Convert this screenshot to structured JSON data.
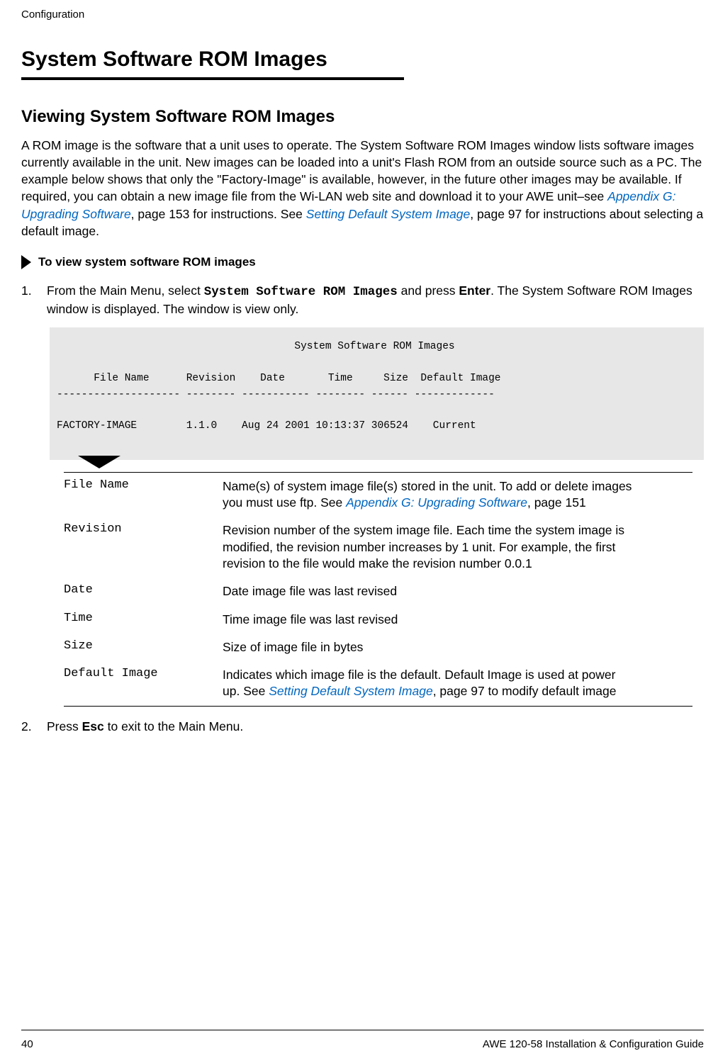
{
  "header": {
    "section_label": "Configuration"
  },
  "section": {
    "title": "System Software ROM Images"
  },
  "subsection": {
    "title": "Viewing System Software ROM Images",
    "intro_pre": "A ROM image is the software that a unit uses to operate. The System Software ROM Images window lists software images currently available in the unit. New images can be loaded into a unit's Flash ROM from an outside source such as a PC. The example below shows that only the \"Factory-Image\" is available, however, in the future other images may be available. If required, you can obtain a new image file from the Wi-LAN web site and download it to your AWE unit–see ",
    "intro_link1": "Appendix G: Upgrading Software",
    "intro_mid": ", page 153 for instructions. See ",
    "intro_link2": "Setting Default System Image",
    "intro_post": ", page 97 for instructions about selecting a default image."
  },
  "procedure": {
    "heading": "To view system software ROM images",
    "step1_pre": "From the Main Menu, select ",
    "step1_mono": "System Software ROM Images",
    "step1_mid": " and press ",
    "step1_key": "Enter",
    "step1_post": ". The System Software ROM Images window is displayed. The window is view only.",
    "step2_pre": "Press ",
    "step2_key": "Esc",
    "step2_post": " to exit to the Main Menu."
  },
  "screenshot": {
    "title": "System Software ROM Images",
    "header_row": "      File Name      Revision    Date       Time     Size  Default Image",
    "divider_row": "-------------------- -------- ----------- -------- ------ -------------",
    "data_row": "FACTORY-IMAGE        1.1.0    Aug 24 2001 10:13:37 306524    Current"
  },
  "definitions": [
    {
      "label": "File Name",
      "value_pre": "Name(s) of system image file(s) stored in the unit. To add or delete images you must use ftp. See ",
      "value_link": "Appendix G: Upgrading Software",
      "value_post": ", page 151"
    },
    {
      "label": "Revision",
      "value_pre": "Revision number of the system image file. Each time the system image is modified, the revision number increases by 1 unit. For example, the first revision to the file would make the revision number 0.0.1",
      "value_link": "",
      "value_post": ""
    },
    {
      "label": "Date",
      "value_pre": "Date image file was last revised",
      "value_link": "",
      "value_post": ""
    },
    {
      "label": "Time",
      "value_pre": "Time image file was last revised",
      "value_link": "",
      "value_post": ""
    },
    {
      "label": "Size",
      "value_pre": "Size of image file in bytes",
      "value_link": "",
      "value_post": ""
    },
    {
      "label": "Default Image",
      "value_pre": "Indicates which image file is the default. Default Image is used at power up. See ",
      "value_link": "Setting Default System Image",
      "value_post": ", page 97 to modify default image"
    }
  ],
  "footer": {
    "page_number": "40",
    "doc_title": "AWE 120-58 Installation & Configuration Guide"
  }
}
